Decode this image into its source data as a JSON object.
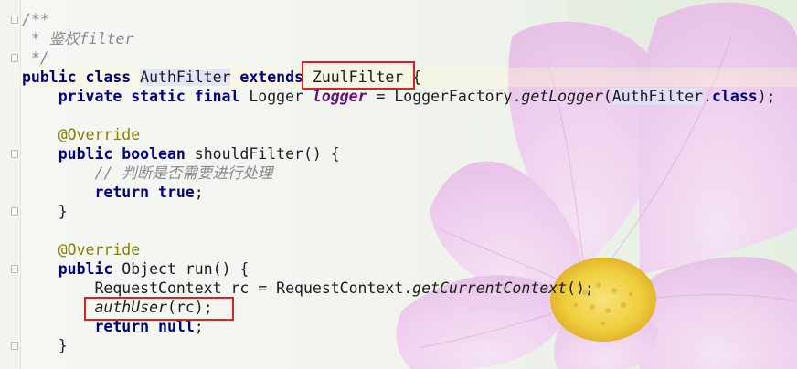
{
  "editor": {
    "lines": [
      {
        "hl": false,
        "segs": [
          {
            "c": "cm",
            "t": "/**"
          }
        ]
      },
      {
        "hl": false,
        "segs": [
          {
            "c": "cm",
            "t": " * 鉴权filter"
          }
        ]
      },
      {
        "hl": false,
        "segs": [
          {
            "c": "cm",
            "t": " */"
          }
        ]
      },
      {
        "hl": true,
        "segs": [
          {
            "c": "kw",
            "t": "public class "
          },
          {
            "c": "ref",
            "t": "AuthFilter"
          },
          {
            "c": "",
            "t": " "
          },
          {
            "c": "kw",
            "t": "extends"
          },
          {
            "c": "",
            "t": " ZuulFilter {"
          }
        ]
      },
      {
        "hl": false,
        "segs": [
          {
            "c": "",
            "t": "    "
          },
          {
            "c": "kw",
            "t": "private static final "
          },
          {
            "c": "",
            "t": "Logger "
          },
          {
            "c": "sf",
            "t": "logger"
          },
          {
            "c": "",
            "t": " = LoggerFactory."
          },
          {
            "c": "it",
            "t": "getLogger"
          },
          {
            "c": "",
            "t": "("
          },
          {
            "c": "ref",
            "t": "AuthFilter"
          },
          {
            "c": "",
            "t": "."
          },
          {
            "c": "kw",
            "t": "class"
          },
          {
            "c": "",
            "t": ");"
          }
        ]
      },
      {
        "hl": false,
        "segs": [
          {
            "c": "",
            "t": " "
          }
        ]
      },
      {
        "hl": false,
        "segs": [
          {
            "c": "",
            "t": "    "
          },
          {
            "c": "an",
            "t": "@Override"
          }
        ]
      },
      {
        "hl": false,
        "segs": [
          {
            "c": "",
            "t": "    "
          },
          {
            "c": "kw",
            "t": "public boolean "
          },
          {
            "c": "",
            "t": "shouldFilter() {"
          }
        ]
      },
      {
        "hl": false,
        "segs": [
          {
            "c": "",
            "t": "        "
          },
          {
            "c": "cm",
            "t": "// 判断是否需要进行处理"
          }
        ]
      },
      {
        "hl": false,
        "segs": [
          {
            "c": "",
            "t": "        "
          },
          {
            "c": "kw",
            "t": "return true"
          },
          {
            "c": "",
            "t": ";"
          }
        ]
      },
      {
        "hl": false,
        "segs": [
          {
            "c": "",
            "t": "    }"
          }
        ]
      },
      {
        "hl": false,
        "segs": [
          {
            "c": "",
            "t": " "
          }
        ]
      },
      {
        "hl": false,
        "segs": [
          {
            "c": "",
            "t": "    "
          },
          {
            "c": "an",
            "t": "@Override"
          }
        ]
      },
      {
        "hl": false,
        "segs": [
          {
            "c": "",
            "t": "    "
          },
          {
            "c": "kw",
            "t": "public "
          },
          {
            "c": "",
            "t": "Object run() {"
          }
        ]
      },
      {
        "hl": false,
        "segs": [
          {
            "c": "",
            "t": "        RequestContext rc = RequestContext."
          },
          {
            "c": "it",
            "t": "getCurrentContext"
          },
          {
            "c": "",
            "t": "();"
          }
        ]
      },
      {
        "hl": false,
        "segs": [
          {
            "c": "",
            "t": "        "
          },
          {
            "c": "it",
            "t": "authUser"
          },
          {
            "c": "",
            "t": "(rc);"
          }
        ]
      },
      {
        "hl": false,
        "segs": [
          {
            "c": "",
            "t": "        "
          },
          {
            "c": "kw",
            "t": "return null"
          },
          {
            "c": "",
            "t": ";"
          }
        ]
      },
      {
        "hl": false,
        "segs": [
          {
            "c": "",
            "t": "    }"
          }
        ]
      }
    ]
  },
  "annotations": {
    "box_color": "#e02020",
    "boxed": [
      "ZuulFilter",
      "authUser(rc);"
    ]
  },
  "background": {
    "subject": "pink cosmos flower",
    "petal_color": "#ecc6ec",
    "center_color": "#f2d64a"
  }
}
